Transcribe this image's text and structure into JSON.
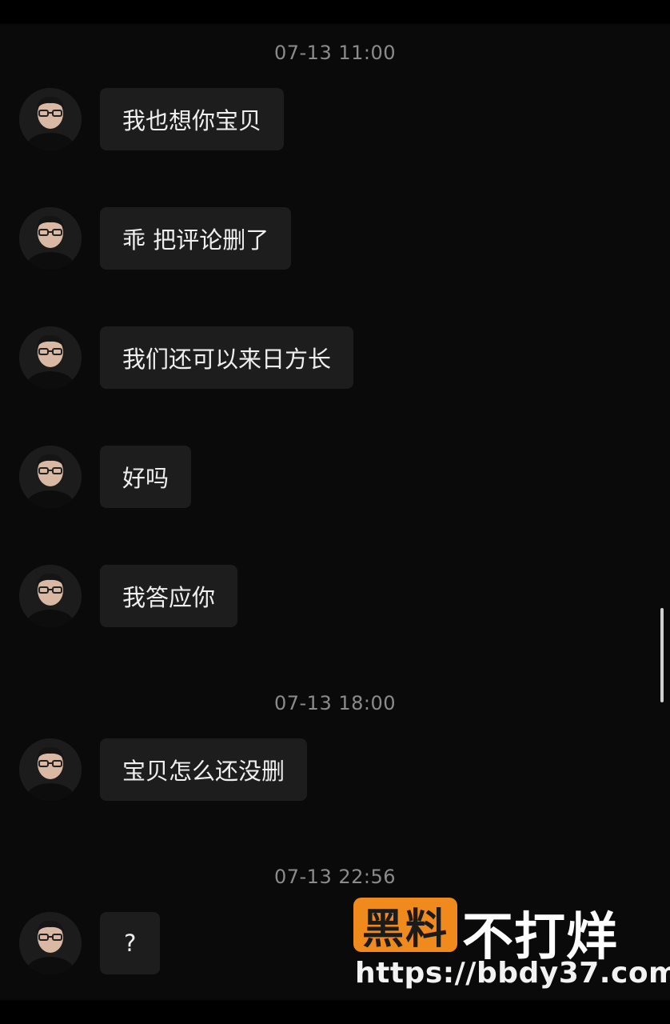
{
  "conversation": {
    "groups": [
      {
        "timestamp": "07-13 11:00",
        "messages": [
          {
            "text": "我也想你宝贝"
          },
          {
            "text": "乖 把评论删了"
          },
          {
            "text": "我们还可以来日方长"
          },
          {
            "text": "好吗"
          },
          {
            "text": "我答应你"
          }
        ]
      },
      {
        "timestamp": "07-13 18:00",
        "messages": [
          {
            "text": "宝贝怎么还没删"
          }
        ]
      },
      {
        "timestamp": "07-13 22:56",
        "messages": [
          {
            "text": "?"
          }
        ]
      }
    ]
  },
  "watermark": {
    "badge": "黑料",
    "text": "不打烊",
    "url": "https://bbdy37.com"
  },
  "colors": {
    "background": "#0a0a0a",
    "bubble": "#1d1d1d",
    "timestamp": "#8b8b8b",
    "watermark_badge": "#f08a1c"
  }
}
